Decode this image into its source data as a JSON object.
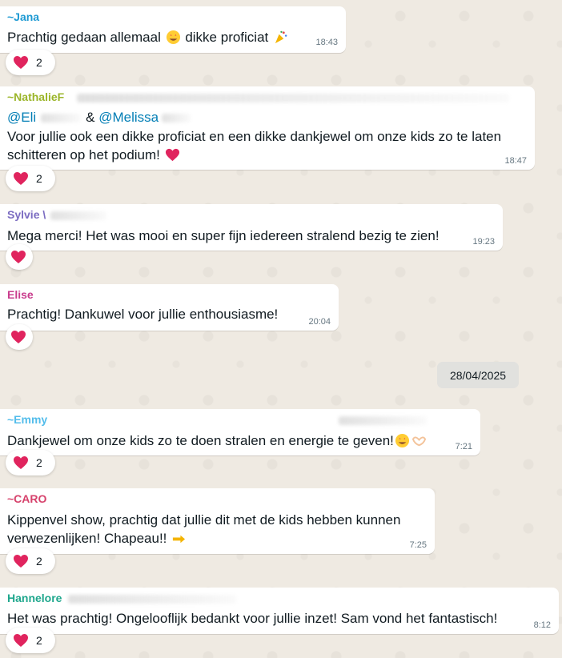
{
  "colors": {
    "background": "#efeae2",
    "bubble": "#ffffff",
    "reaction_heart": "#e0245e",
    "timestamp": "#667781",
    "mention": "#027eb5"
  },
  "messages": [
    {
      "sender": "~Jana",
      "sender_color": "#1e9ad3",
      "text": "Prachtig gedaan allemaal",
      "text_suffix": "dikke proficiat",
      "emojis": [
        "star-struck-emoji",
        "party-popper-emoji"
      ],
      "time": "18:43",
      "reaction": {
        "icon": "heart-icon",
        "count": "2"
      }
    },
    {
      "sender": "~NathalieF",
      "sender_color": "#9bb529",
      "mention_1": "@Eli",
      "mention_sep": "&",
      "mention_2": "@Melissa",
      "text": "Voor jullie ook een dikke proficiat en een dikke dankjewel om onze kids zo te laten schitteren op het podium!",
      "emojis": [
        "red-heart-emoji"
      ],
      "time": "18:47",
      "reaction": {
        "icon": "heart-icon",
        "count": "2"
      }
    },
    {
      "sender": "Sylvie \\",
      "sender_color": "#7b6cc1",
      "text": "Mega merci! Het was mooi en super fijn iedereen stralend bezig te zien!",
      "time": "19:23",
      "reaction": {
        "icon": "heart-icon",
        "count": ""
      }
    },
    {
      "sender": "Elise",
      "sender_color": "#c93d8d",
      "text": "Prachtig! Dankuwel voor jullie enthousiasme!",
      "time": "20:04",
      "reaction": {
        "icon": "heart-icon",
        "count": ""
      }
    },
    {
      "sender": "~Emmy",
      "sender_color": "#53bdeb",
      "text": "Dankjewel om onze kids zo te doen stralen en energie te geven!",
      "emojis": [
        "star-struck-emoji",
        "heart-hands-emoji"
      ],
      "time": "7:21",
      "reaction": {
        "icon": "heart-icon",
        "count": "2"
      }
    },
    {
      "sender": "~CARO",
      "sender_color": "#d6416b",
      "text": "Kippenvel show, prachtig dat jullie dit met de kids hebben kunnen verwezenlijken! Chapeau!!",
      "emojis": [
        "pointing-hand-emoji"
      ],
      "time": "7:25",
      "reaction": {
        "icon": "heart-icon",
        "count": "2"
      }
    },
    {
      "sender": "Hannelore",
      "sender_color": "#1fa78d",
      "text": "Het was prachtig! Ongelooflijk bedankt voor jullie inzet! Sam vond het fantastisch!",
      "time": "8:12",
      "reaction": {
        "icon": "heart-icon",
        "count": "2"
      }
    }
  ],
  "date_separator": "28/04/2025"
}
